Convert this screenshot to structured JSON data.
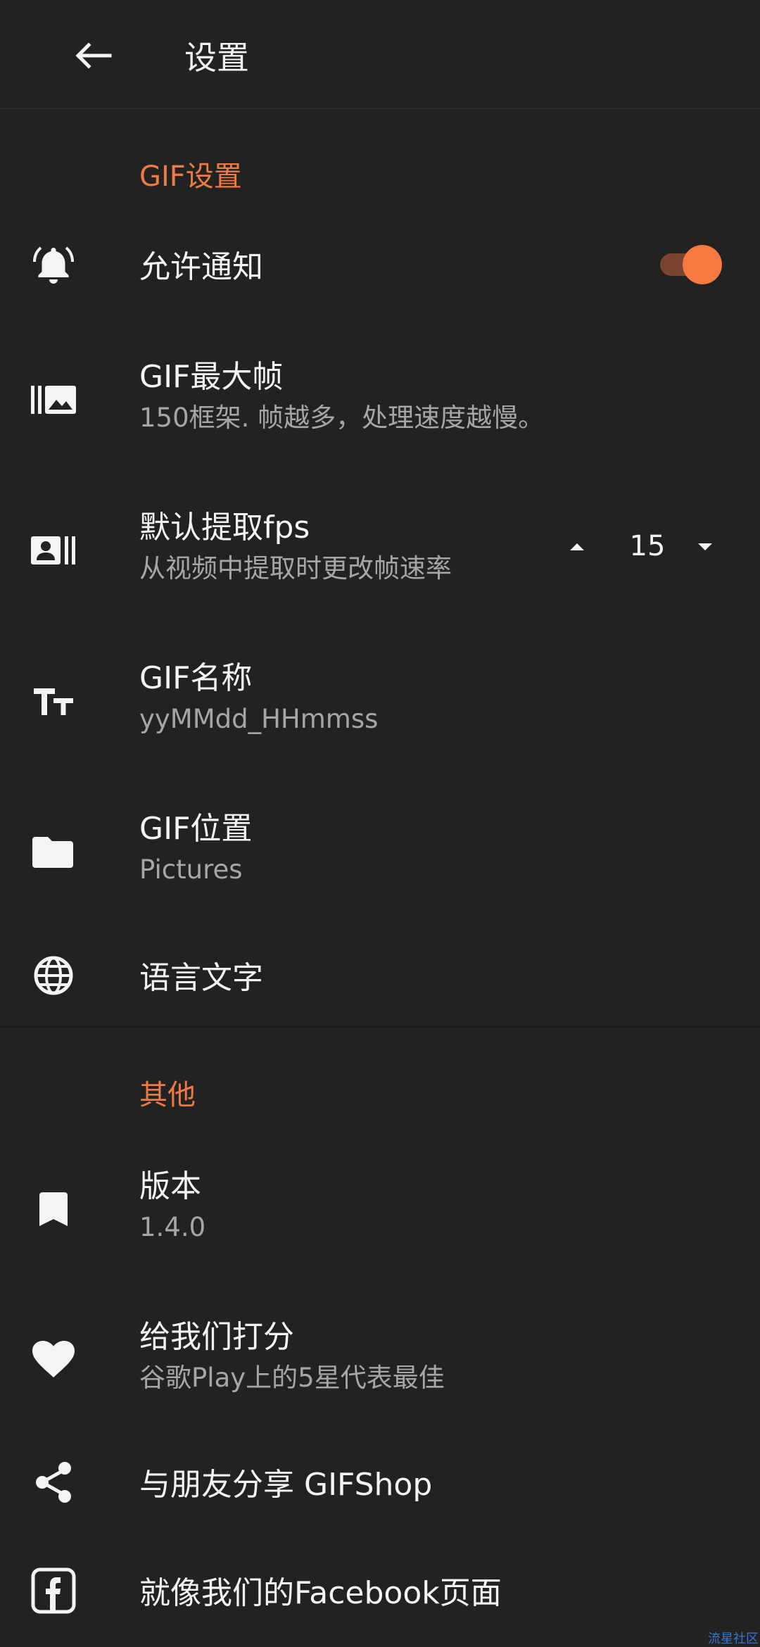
{
  "appbar": {
    "title": "设置"
  },
  "sections": {
    "gif": {
      "header": "GIF设置"
    },
    "other": {
      "header": "其他"
    }
  },
  "items": {
    "notifications": {
      "title": "允许通知",
      "enabled": true
    },
    "max_frames": {
      "title": "GIF最大帧",
      "subtitle": "150框架. 帧越多，处理速度越慢。"
    },
    "fps": {
      "title": "默认提取fps",
      "subtitle": "从视频中提取时更改帧速率",
      "value": "15"
    },
    "gif_name": {
      "title": "GIF名称",
      "subtitle": "yyMMdd_HHmmss"
    },
    "gif_location": {
      "title": "GIF位置",
      "subtitle": "Pictures"
    },
    "language": {
      "title": "语言文字"
    },
    "version": {
      "title": "版本",
      "subtitle": "1.4.0"
    },
    "rate": {
      "title": "给我们打分",
      "subtitle": "谷歌Play上的5星代表最佳"
    },
    "share": {
      "title": "与朋友分享 GIFShop"
    },
    "facebook": {
      "title": "就像我们的Facebook页面"
    }
  },
  "watermark": "流星社区",
  "colors": {
    "background": "#222222",
    "accent": "#ee7a45",
    "subtitle": "#a6a6a6"
  }
}
